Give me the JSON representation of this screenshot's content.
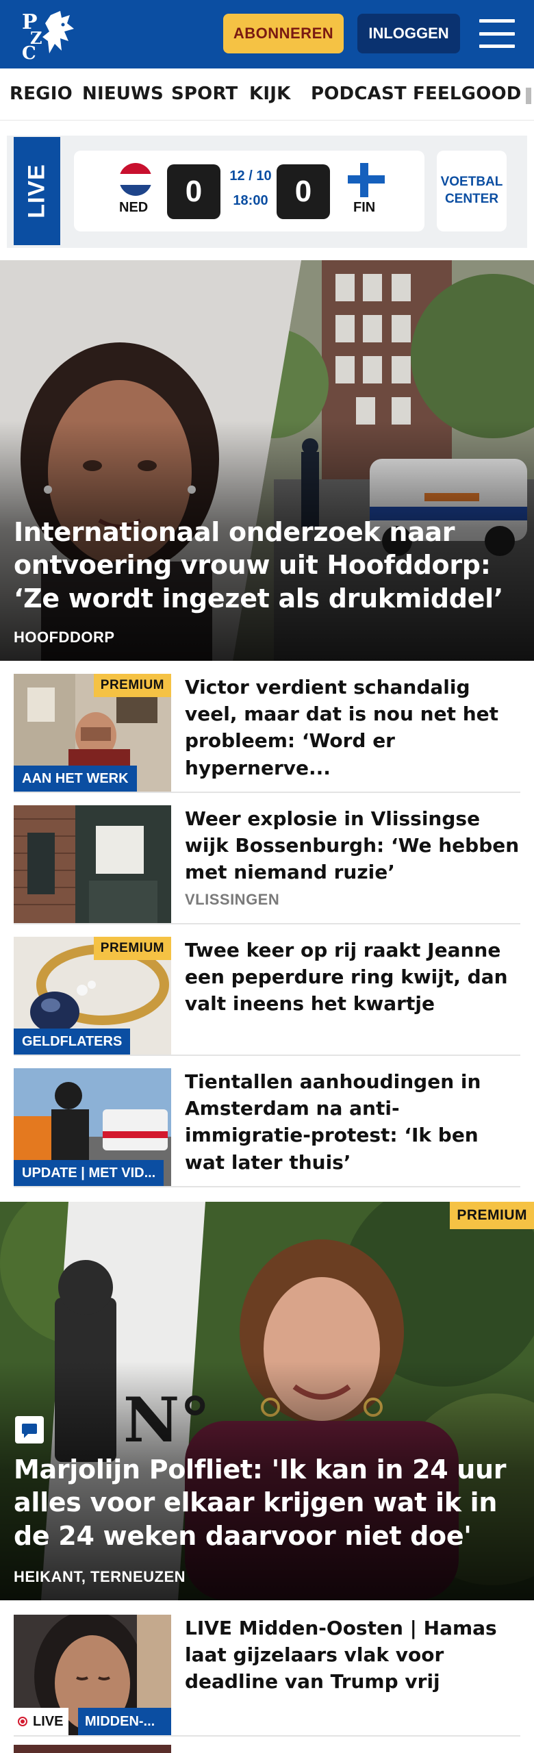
{
  "header": {
    "logo_text": "PZC",
    "subscribe_label": "ABONNEREN",
    "login_label": "INLOGGEN",
    "menu_icon": "hamburger-icon",
    "brand_color": "#0b4ea2",
    "subscribe_color": "#f5c244"
  },
  "nav": {
    "items": [
      "REGIO",
      "NIEUWS",
      "SPORT",
      "KIJK",
      "PODCAST",
      "FEELGOOD"
    ]
  },
  "live_match": {
    "live_label": "LIVE",
    "home_team": "NED",
    "home_score": "0",
    "away_team": "FIN",
    "away_score": "0",
    "date": "12 / 10",
    "time": "18:00",
    "center_label": "VOETBAL\nCENTER"
  },
  "hero": {
    "title": "Internationaal onderzoek naar ontvoering vrouw uit Hoofddorp: ‘Ze wordt ingezet als drukmiddel’",
    "location": "HOOFDDORP"
  },
  "articles": [
    {
      "title": "Victor verdient schandalig veel, maar dat is nou net het probleem: ‘Word er hypernerve...",
      "premium": "PREMIUM",
      "thumb_label": "AAN HET WERK"
    },
    {
      "title": "Weer explosie in Vlissingse wijk Bossenburgh: ‘We hebben met niemand ruzie’",
      "location": "VLISSINGEN"
    },
    {
      "title": "Twee keer op rij raakt Jeanne een peperdure ring kwijt, dan valt ineens het kwartje",
      "premium": "PREMIUM",
      "thumb_label": "GELDFLATERS"
    },
    {
      "title": "Tientallen aanhoudingen in Amsterdam na anti-immigratie-protest: ‘Ik ben wat later thuis’",
      "thumb_label": "UPDATE | MET VID..."
    }
  ],
  "hero2": {
    "title": "Marjolijn Polfliet: 'Ik kan in 24 uur alles voor elkaar krijgen wat ik in de 24 weken daarvoor niet doe'",
    "location": "HEIKANT, TERNEUZEN",
    "premium": "PREMIUM"
  },
  "live_article": {
    "title": "LIVE Midden-Oosten | Hamas laat gijzelaars vlak voor deadline van Trump vrij",
    "live_label": "LIVE",
    "chip_label": "MIDDEN-..."
  }
}
